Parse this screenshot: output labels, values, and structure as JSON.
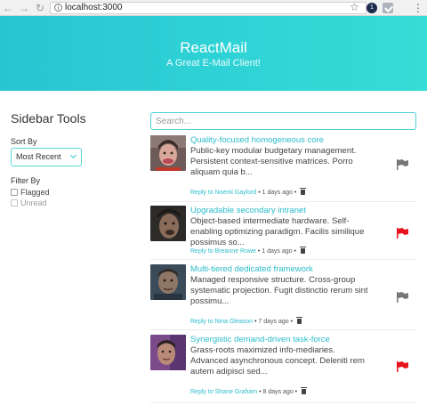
{
  "browser": {
    "url": "localhost:3000",
    "ext_badge": "1"
  },
  "hero": {
    "title": "ReactMail",
    "subtitle": "A Great E-Mail Client!"
  },
  "sidebar": {
    "title": "Sidebar Tools",
    "sort_label": "Sort By",
    "sort_value": "Most Recent",
    "filter_label": "Filter By",
    "filters": [
      {
        "label": "Flagged",
        "checked": false
      },
      {
        "label": "Unread",
        "checked": false
      }
    ]
  },
  "search": {
    "placeholder": "Search..."
  },
  "messages": [
    {
      "subject": "Quality-focused homogeneous core",
      "body": "Public-key modular budgetary management. Persistent context-sensitive matrices. Porro aliquam quia b...",
      "reply": "Reply to Noemi Gaylord",
      "time": "1 days ago",
      "flagged": false
    },
    {
      "subject": "Upgradable secondary intranet",
      "body": "Object-based intermediate hardware. Self-enabling optimizing paradigm. Facilis similique possimus so...",
      "reply": "Reply to Breanne Rowe",
      "time": "1 days ago",
      "flagged": true
    },
    {
      "subject": "Multi-tiered dedicated framework",
      "body": "Managed responsive structure. Cross-group systematic projection. Fugit distinctio rerum sint possimu...",
      "reply": "Reply to Nina Gleason",
      "time": "7 days ago",
      "flagged": false
    },
    {
      "subject": "Synergistic demand-driven task-force",
      "body": "Grass-roots maximized info-mediaries. Advanced asynchronous concept. Deleniti rem autem adipisci sed...",
      "reply": "Reply to Shane Graham",
      "time": "8 days ago",
      "flagged": true
    }
  ],
  "colors": {
    "accent": "#2bbccb",
    "flag_on": "#e8141b",
    "flag_off": "#777777"
  }
}
